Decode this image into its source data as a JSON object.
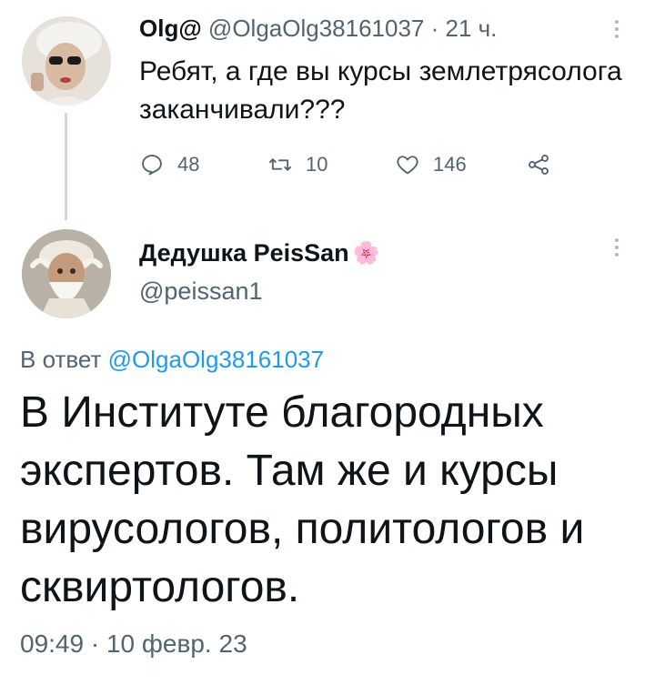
{
  "parent": {
    "name": "Olg@",
    "handle": "@OlgaOlg38161037",
    "time": "· 21 ч.",
    "text": "Ребят, а где вы курсы землетрясолога заканчивали???",
    "actions": {
      "replies": "48",
      "retweets": "10",
      "likes": "146"
    },
    "icons": [
      "reply-icon",
      "retweet-icon",
      "like-icon",
      "share-icon",
      "more-icon"
    ]
  },
  "main": {
    "name": "Дедушка PeisSan",
    "name_emoji": "🌸",
    "handle": "@peissan1",
    "reply_prefix": "В ответ",
    "reply_handle": "@OlgaOlg38161037",
    "text": "В Институте благородных экспертов. Там же и курсы вирусологов, политологов и сквиртологов.",
    "timestamp": "09:49 · 10 февр. 23"
  },
  "colors": {
    "text": "#0f1419",
    "secondary": "#536471",
    "link": "#1d9bf0",
    "thread_line": "#cfd9de"
  }
}
